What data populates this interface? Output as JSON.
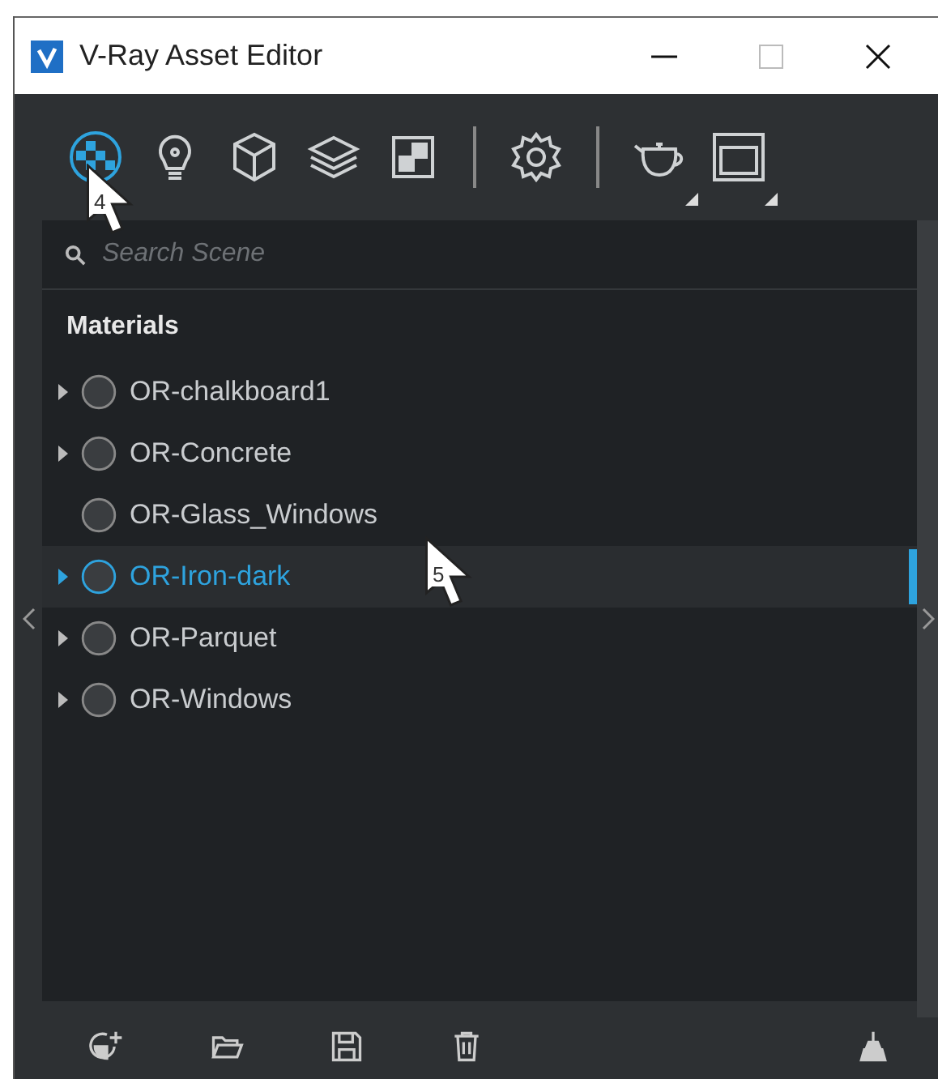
{
  "window": {
    "title": "V-Ray Asset Editor"
  },
  "toolbar": [
    {
      "kind": "materials",
      "selected": true,
      "menu": false,
      "cursor_label": "4"
    },
    {
      "kind": "lights",
      "selected": false,
      "menu": false
    },
    {
      "kind": "geometry",
      "selected": false,
      "menu": false
    },
    {
      "kind": "layers",
      "selected": false,
      "menu": false
    },
    {
      "kind": "textures",
      "selected": false,
      "menu": false
    },
    {
      "kind": "separator"
    },
    {
      "kind": "settings",
      "selected": false,
      "menu": false
    },
    {
      "kind": "separator"
    },
    {
      "kind": "render",
      "selected": false,
      "menu": true
    },
    {
      "kind": "frame-buffer",
      "selected": false,
      "menu": true
    }
  ],
  "search": {
    "placeholder": "Search Scene"
  },
  "section": "Materials",
  "materials": [
    {
      "name": "OR-chalkboard1",
      "expandable": true,
      "selected": false
    },
    {
      "name": "OR-Concrete",
      "expandable": true,
      "selected": false
    },
    {
      "name": "OR-Glass_Windows",
      "expandable": false,
      "selected": false
    },
    {
      "name": "OR-Iron-dark",
      "expandable": true,
      "selected": true,
      "cursor_label": "5"
    },
    {
      "name": "OR-Parquet",
      "expandable": true,
      "selected": false
    },
    {
      "name": "OR-Windows",
      "expandable": true,
      "selected": false
    }
  ],
  "bottom_tools": [
    {
      "kind": "add-material"
    },
    {
      "kind": "open"
    },
    {
      "kind": "save"
    },
    {
      "kind": "delete"
    },
    {
      "kind": "spacer"
    },
    {
      "kind": "clean"
    }
  ]
}
